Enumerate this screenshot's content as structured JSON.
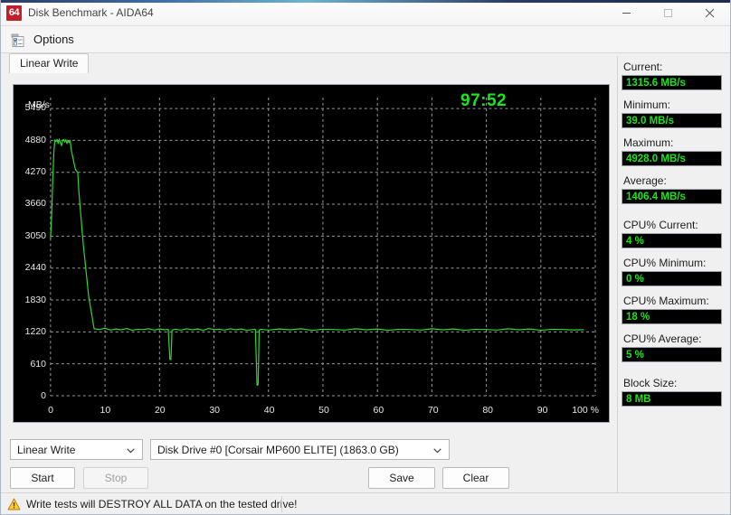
{
  "window": {
    "title": "Disk Benchmark - AIDA64",
    "logo_text": "64",
    "minimize_icon": "minimize-icon",
    "maximize_icon": "maximize-icon",
    "close_icon": "close-icon"
  },
  "toolbar": {
    "options_label": "Options",
    "options_icon": "options-checklist-icon"
  },
  "tabs": [
    {
      "label": "Linear Write",
      "selected": true
    }
  ],
  "graph": {
    "timer": "97:52",
    "y_axis_unit": "MB/s",
    "x_axis_unit": "%"
  },
  "controls": {
    "test_type": {
      "value": "Linear Write",
      "chevron_icon": "chevron-down-icon"
    },
    "drive": {
      "value": "Disk Drive #0  [Corsair MP600 ELITE]  (1863.0 GB)",
      "chevron_icon": "chevron-down-icon"
    },
    "start_label": "Start",
    "stop_label": "Stop",
    "stop_disabled": true,
    "save_label": "Save",
    "clear_label": "Clear"
  },
  "status": {
    "warning_icon": "warning-triangle-icon",
    "text": "Write tests will DESTROY ALL DATA on the tested drive!"
  },
  "stats": [
    {
      "label": "Current:",
      "value": "1315.6 MB/s",
      "group": 0
    },
    {
      "label": "Minimum:",
      "value": "39.0 MB/s",
      "group": 0
    },
    {
      "label": "Maximum:",
      "value": "4928.0 MB/s",
      "group": 0
    },
    {
      "label": "Average:",
      "value": "1406.4 MB/s",
      "group": 0
    },
    {
      "label": "CPU% Current:",
      "value": "4 %",
      "group": 1
    },
    {
      "label": "CPU% Minimum:",
      "value": "0 %",
      "group": 1
    },
    {
      "label": "CPU% Maximum:",
      "value": "18 %",
      "group": 1
    },
    {
      "label": "CPU% Average:",
      "value": "5 %",
      "group": 1
    },
    {
      "label": "Block Size:",
      "value": "8 MB",
      "group": 2
    }
  ],
  "colors": {
    "graph_bg": "#000000",
    "graph_line": "#2fd82f",
    "grid": "#9a9a9a",
    "stat_text": "#19e619",
    "accent": "#c0202a"
  },
  "chart_data": {
    "type": "line",
    "title": "Linear Write",
    "xlabel": "100 %",
    "ylabel": "MB/s",
    "xlim": [
      0,
      100
    ],
    "ylim": [
      0,
      5700
    ],
    "grid": true,
    "legend": null,
    "ytick_labels": [
      "0",
      "610",
      "1220",
      "1830",
      "2440",
      "3050",
      "3660",
      "4270",
      "4880",
      "5490"
    ],
    "yticks": [
      0,
      610,
      1220,
      1830,
      2440,
      3050,
      3660,
      4270,
      4880,
      5490
    ],
    "xtick_labels": [
      "0",
      "10",
      "20",
      "30",
      "40",
      "50",
      "60",
      "70",
      "80",
      "90",
      "100 %"
    ],
    "xticks": [
      0,
      10,
      20,
      30,
      40,
      50,
      60,
      70,
      80,
      90,
      100
    ],
    "series": [
      {
        "name": "Linear Write",
        "color": "#2fd82f",
        "x": [
          0.0,
          0.2,
          0.4,
          0.6,
          0.8,
          1.0,
          1.2,
          1.4,
          1.6,
          1.8,
          2.0,
          2.2,
          2.4,
          2.6,
          2.8,
          3.0,
          3.2,
          3.4,
          3.6,
          3.8,
          4.0,
          4.2,
          4.4,
          4.6,
          4.8,
          5.0,
          5.2,
          5.6,
          6.0,
          6.5,
          7.0,
          8.0,
          9.0,
          10.0,
          11.0,
          12.0,
          13.0,
          14.0,
          15.0,
          16.0,
          17.0,
          18.0,
          19.0,
          20.0,
          21.0,
          21.6,
          21.9,
          22.1,
          22.3,
          22.6,
          23.0,
          24.0,
          25.0,
          26.0,
          27.0,
          28.0,
          29.0,
          30.0,
          31.0,
          32.0,
          33.0,
          34.0,
          35.0,
          36.0,
          37.0,
          37.6,
          37.9,
          38.1,
          38.3,
          38.6,
          39.0,
          40.0,
          42.0,
          44.0,
          46.0,
          48.0,
          50.0,
          52.0,
          54.0,
          56.0,
          58.0,
          60.0,
          62.0,
          64.0,
          66.0,
          68.0,
          70.0,
          72.0,
          74.0,
          76.0,
          78.0,
          80.0,
          82.0,
          84.0,
          86.0,
          88.0,
          90.0,
          92.0,
          94.0,
          96.0,
          97.9
        ],
        "y": [
          3000,
          3450,
          4100,
          4650,
          4890,
          4860,
          4900,
          4820,
          4905,
          4840,
          4780,
          4870,
          4900,
          4850,
          4895,
          4820,
          4870,
          4840,
          4880,
          4700,
          4600,
          4500,
          4400,
          4320,
          4290,
          4270,
          3900,
          3400,
          2900,
          2400,
          1900,
          1280,
          1265,
          1290,
          1255,
          1275,
          1260,
          1285,
          1250,
          1270,
          1265,
          1280,
          1255,
          1275,
          1260,
          1270,
          700,
          690,
          1250,
          1265,
          1270,
          1255,
          1280,
          1260,
          1275,
          1250,
          1285,
          1265,
          1270,
          1255,
          1280,
          1260,
          1275,
          1250,
          1265,
          1270,
          200,
          210,
          1255,
          1270,
          1265,
          1255,
          1275,
          1260,
          1280,
          1250,
          1270,
          1265,
          1255,
          1280,
          1260,
          1275,
          1250,
          1270,
          1265,
          1255,
          1280,
          1260,
          1275,
          1250,
          1270,
          1265,
          1255,
          1280,
          1260,
          1275,
          1250,
          1270,
          1265,
          1258,
          1262
        ]
      }
    ],
    "annotations": [
      {
        "text": "97:52",
        "x": 52,
        "y": 5480,
        "color": "#19e619"
      }
    ],
    "summary": {
      "current": 1315.6,
      "minimum": 39.0,
      "maximum": 4928.0,
      "average": 1406.4,
      "cpu_current": 4,
      "cpu_minimum": 0,
      "cpu_maximum": 18,
      "cpu_average": 5,
      "block_size_mb": 8
    }
  }
}
